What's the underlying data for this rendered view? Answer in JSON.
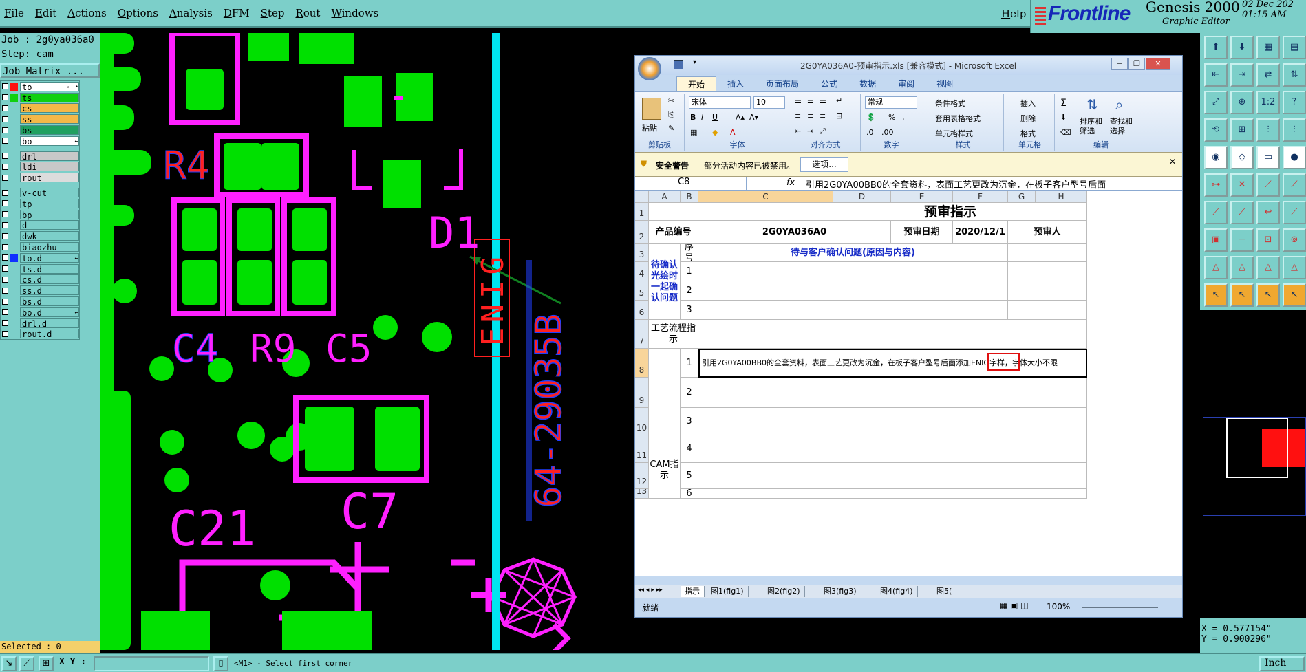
{
  "menubar": {
    "items": [
      "File",
      "Edit",
      "Actions",
      "Options",
      "Analysis",
      "DFM",
      "Step",
      "Rout",
      "Windows"
    ],
    "help": "Help"
  },
  "brand": {
    "logo": "Frontline",
    "product": "Genesis 2000",
    "subtitle": "Graphic Editor",
    "date": "02 Dec 202",
    "time": "01:15 AM"
  },
  "job": {
    "job_line": "Job : 2g0ya036a0",
    "step_line": "Step: cam",
    "matrix_button": "Job Matrix ..."
  },
  "layers": [
    {
      "name": "to",
      "swatch": "#ff1010",
      "bg": "#ffffff",
      "flag": "← •"
    },
    {
      "name": "ts",
      "swatch": "#10d010",
      "bg": "#10d010",
      "flag": ""
    },
    {
      "name": "cs",
      "swatch": "",
      "bg": "#f4b848",
      "flag": ""
    },
    {
      "name": "ss",
      "swatch": "",
      "bg": "#f4b848",
      "flag": ""
    },
    {
      "name": "bs",
      "swatch": "",
      "bg": "#20a060",
      "flag": ""
    },
    {
      "name": "bo",
      "swatch": "",
      "bg": "#ffffff",
      "flag": "←"
    },
    {
      "gap": true
    },
    {
      "name": "drl",
      "swatch": "",
      "bg": "#c8c8c8",
      "flag": ""
    },
    {
      "name": "ldi",
      "swatch": "",
      "bg": "#c8c8c8",
      "flag": ""
    },
    {
      "name": "rout",
      "swatch": "",
      "bg": "#dcdcdc",
      "flag": ""
    },
    {
      "gap": true
    },
    {
      "name": "v-cut",
      "swatch": "",
      "bg": "#7ccfc9",
      "flag": ""
    },
    {
      "name": "tp",
      "swatch": "",
      "bg": "#7ccfc9",
      "flag": ""
    },
    {
      "name": "bp",
      "swatch": "",
      "bg": "#7ccfc9",
      "flag": ""
    },
    {
      "name": "d",
      "swatch": "",
      "bg": "#7ccfc9",
      "flag": ""
    },
    {
      "name": "dwk",
      "swatch": "",
      "bg": "#7ccfc9",
      "flag": ""
    },
    {
      "name": "biaozhu",
      "swatch": "",
      "bg": "#7ccfc9",
      "flag": ""
    },
    {
      "name": "to.d",
      "swatch": "#1030ff",
      "bg": "#7ccfc9",
      "flag": "←"
    },
    {
      "name": "ts.d",
      "swatch": "",
      "bg": "#7ccfc9",
      "flag": ""
    },
    {
      "name": "cs.d",
      "swatch": "",
      "bg": "#7ccfc9",
      "flag": ""
    },
    {
      "name": "ss.d",
      "swatch": "",
      "bg": "#7ccfc9",
      "flag": ""
    },
    {
      "name": "bs.d",
      "swatch": "",
      "bg": "#7ccfc9",
      "flag": ""
    },
    {
      "name": "bo.d",
      "swatch": "",
      "bg": "#7ccfc9",
      "flag": "←"
    },
    {
      "name": "drl.d",
      "swatch": "",
      "bg": "#7ccfc9",
      "flag": ""
    },
    {
      "name": "rout.d",
      "swatch": "",
      "bg": "#7ccfc9",
      "flag": ""
    }
  ],
  "selected": "Selected : 0",
  "bottombar": {
    "xy_label": "X Y :",
    "status": "<M1> - Select first corner",
    "unit": "Inch"
  },
  "coords": {
    "x": "X = 0.577154\"",
    "y": "Y = 0.900296\""
  },
  "pcb": {
    "labels": [
      "R4",
      "D1",
      "C4",
      "R9",
      "C5",
      "C21",
      "C7"
    ],
    "enig": "ENIG",
    "part_number": "64-29035B"
  },
  "excel": {
    "title": "2G0YA036A0-预审指示.xls [兼容模式] - Microsoft Excel",
    "tabs": [
      "开始",
      "插入",
      "页面布局",
      "公式",
      "数据",
      "审阅",
      "视图"
    ],
    "ribbon": {
      "paste": "粘贴",
      "clipboard": "剪贴板",
      "font_name": "宋体",
      "font_size": "10",
      "font_group": "字体",
      "align_group": "对齐方式",
      "number_format": "常规",
      "number_group": "数字",
      "cond_format": "条件格式",
      "table_format": "套用表格格式",
      "cell_style": "单元格样式",
      "style_group": "样式",
      "insert": "插入",
      "delete": "删除",
      "format": "格式",
      "cells_group": "单元格",
      "sort_filter": "排序和筛选",
      "find_select": "查找和选择",
      "edit_group": "编辑"
    },
    "warning_title": "安全警告",
    "warning_text": "部分活动内容已被禁用。",
    "options_button": "选项...",
    "name_box": "C8",
    "formula": "引用2G0YA00BB0的全套资料，表面工艺更改为沉金，在板子客户型号后面",
    "columns": [
      "A",
      "B",
      "C",
      "D",
      "E",
      "F",
      "G",
      "H"
    ],
    "rows": [
      "1",
      "2",
      "3",
      "4",
      "5",
      "6",
      "7",
      "8",
      "9",
      "10",
      "11",
      "12",
      "13"
    ],
    "cells": {
      "title": "预审指示",
      "product_label": "产品编号",
      "product_value": "2G0YA036A0",
      "date_label": "预审日期",
      "date_value": "2020/12/1",
      "reviewer_label": "预审人",
      "seq_label": "序号",
      "issues_header": "待与客户确认问题(原因与内容)",
      "confirm_label": "待确认光绘时一起确认问题",
      "seq": [
        "1",
        "2",
        "3"
      ],
      "process_label": "工艺流程指示",
      "cam_label": "CAM指示",
      "cam_seq": [
        "1",
        "2",
        "3",
        "4",
        "5",
        "6"
      ],
      "cam_instruction": "引用2G0YA00BB0的全套资料，表面工艺更改为沉金，在板子客户型号后面添加ENIG字样，字体大小不限"
    },
    "sheet_tabs": [
      "指示",
      "图1(fig1)",
      "图2(fig2)",
      "图3(fig3)",
      "图4(fig4)",
      "图5("
    ],
    "status_left": "就绪",
    "zoom": "100%"
  }
}
